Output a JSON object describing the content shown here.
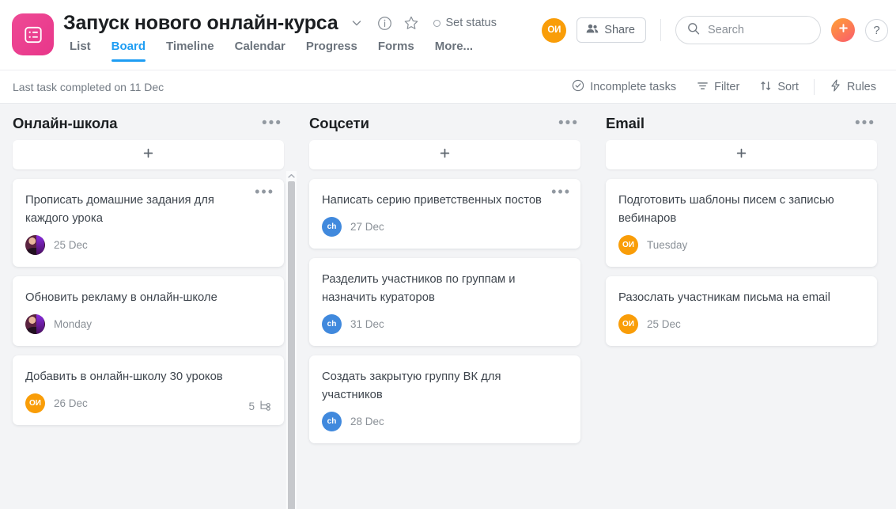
{
  "header": {
    "logo_icon": "list-app-icon",
    "project_title": "Запуск нового онлайн-курса",
    "chevron_icon": "chevron-down-icon",
    "info_icon": "info-circle-icon",
    "star_icon": "star-outline-icon",
    "set_status_label": "Set status",
    "user_avatar_initials": "ОИ",
    "share_label": "Share",
    "share_icon": "people-icon",
    "search_placeholder": "Search",
    "search_value": "",
    "search_icon": "search-icon",
    "add_icon": "plus-icon",
    "help_label": "?",
    "tabs": [
      {
        "label": "List",
        "active": false
      },
      {
        "label": "Board",
        "active": true
      },
      {
        "label": "Timeline",
        "active": false
      },
      {
        "label": "Calendar",
        "active": false
      },
      {
        "label": "Progress",
        "active": false
      },
      {
        "label": "Forms",
        "active": false
      },
      {
        "label": "More...",
        "active": false
      }
    ]
  },
  "toolbar": {
    "last_task": "Last task completed on 11 Dec",
    "incomplete_label": "Incomplete tasks",
    "incomplete_icon": "check-circle-icon",
    "filter_label": "Filter",
    "filter_icon": "filter-icon",
    "sort_label": "Sort",
    "sort_icon": "sort-arrows-icon",
    "rules_label": "Rules",
    "rules_icon": "lightning-icon"
  },
  "colors": {
    "accent_blue": "#1e9df3",
    "brand_pink": "#ec3f8e",
    "avatar_orange": "#f99d08",
    "avatar_blue": "#4089dd",
    "board_bg": "#f3f4f6"
  },
  "board": {
    "add_card_icon": "plus-icon",
    "column_menu_icon": "ellipsis-icon",
    "columns": [
      {
        "title": "Онлайн-школа",
        "cards": [
          {
            "title": "Прописать домашние задания для каждого урока",
            "date": "25 Dec",
            "avatar_type": "photo",
            "avatar_initials": "",
            "menu": true,
            "subtask_count": ""
          },
          {
            "title": "Обновить рекламу в онлайн-школе",
            "date": "Monday",
            "avatar_type": "photo",
            "avatar_initials": "",
            "menu": false,
            "subtask_count": ""
          },
          {
            "title": "Добавить в онлайн-школу 30 уроков",
            "date": "26 Dec",
            "avatar_type": "orange",
            "avatar_initials": "ОИ",
            "menu": false,
            "subtask_count": "5"
          }
        ]
      },
      {
        "title": "Соцсети",
        "cards": [
          {
            "title": "Написать серию приветственных постов",
            "date": "27 Dec",
            "avatar_type": "blue",
            "avatar_initials": "ch",
            "menu": true,
            "subtask_count": ""
          },
          {
            "title": "Разделить участников по группам и назначить кураторов",
            "date": "31 Dec",
            "avatar_type": "blue",
            "avatar_initials": "ch",
            "menu": false,
            "subtask_count": ""
          },
          {
            "title": "Создать закрытую группу ВК для участников",
            "date": "28 Dec",
            "avatar_type": "blue",
            "avatar_initials": "ch",
            "menu": false,
            "subtask_count": ""
          }
        ]
      },
      {
        "title": "Email",
        "cards": [
          {
            "title": "Подготовить шаблоны писем с записью вебинаров",
            "date": "Tuesday",
            "avatar_type": "orange",
            "avatar_initials": "ОИ",
            "menu": false,
            "subtask_count": ""
          },
          {
            "title": "Разослать участникам письма на email",
            "date": "25 Dec",
            "avatar_type": "orange",
            "avatar_initials": "ОИ",
            "menu": false,
            "subtask_count": ""
          }
        ]
      }
    ]
  }
}
